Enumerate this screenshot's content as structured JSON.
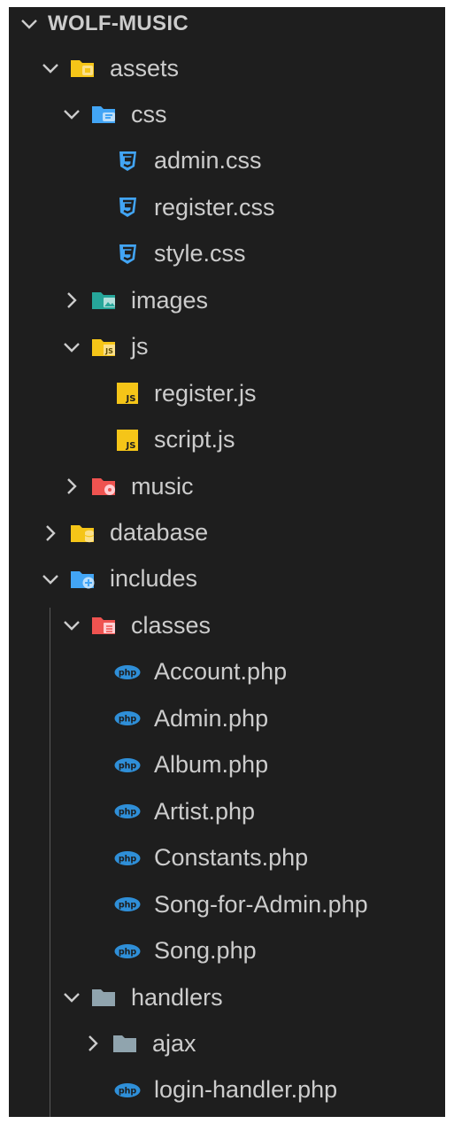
{
  "explorer": {
    "root": "WOLF-MUSIC",
    "items": [
      {
        "label": "assets",
        "type": "folder",
        "icon": "assets-folder-icon",
        "depth": 1,
        "expanded": true
      },
      {
        "label": "css",
        "type": "folder",
        "icon": "css-folder-icon",
        "depth": 2,
        "expanded": true
      },
      {
        "label": "admin.css",
        "type": "file",
        "icon": "css3-file-icon",
        "depth": 3
      },
      {
        "label": "register.css",
        "type": "file",
        "icon": "css3-file-icon",
        "depth": 3
      },
      {
        "label": "style.css",
        "type": "file",
        "icon": "css3-file-icon",
        "depth": 3
      },
      {
        "label": "images",
        "type": "folder",
        "icon": "images-folder-icon",
        "depth": 2,
        "expanded": false
      },
      {
        "label": "js",
        "type": "folder",
        "icon": "js-folder-icon",
        "depth": 2,
        "expanded": true
      },
      {
        "label": "register.js",
        "type": "file",
        "icon": "js-file-icon",
        "depth": 3
      },
      {
        "label": "script.js",
        "type": "file",
        "icon": "js-file-icon",
        "depth": 3
      },
      {
        "label": "music",
        "type": "folder",
        "icon": "music-folder-icon",
        "depth": 2,
        "expanded": false
      },
      {
        "label": "database",
        "type": "folder",
        "icon": "database-folder-icon",
        "depth": 1,
        "expanded": false
      },
      {
        "label": "includes",
        "type": "folder",
        "icon": "includes-folder-icon",
        "depth": 1,
        "expanded": true
      },
      {
        "label": "classes",
        "type": "folder",
        "icon": "classes-folder-icon",
        "depth": 2,
        "expanded": true
      },
      {
        "label": "Account.php",
        "type": "file",
        "icon": "php-file-icon",
        "depth": 3
      },
      {
        "label": "Admin.php",
        "type": "file",
        "icon": "php-file-icon",
        "depth": 3
      },
      {
        "label": "Album.php",
        "type": "file",
        "icon": "php-file-icon",
        "depth": 3
      },
      {
        "label": "Artist.php",
        "type": "file",
        "icon": "php-file-icon",
        "depth": 3
      },
      {
        "label": "Constants.php",
        "type": "file",
        "icon": "php-file-icon",
        "depth": 3
      },
      {
        "label": "Song-for-Admin.php",
        "type": "file",
        "icon": "php-file-icon",
        "depth": 3
      },
      {
        "label": "Song.php",
        "type": "file",
        "icon": "php-file-icon",
        "depth": 3
      },
      {
        "label": "handlers",
        "type": "folder",
        "icon": "handlers-folder-icon",
        "depth": 2,
        "expanded": true
      },
      {
        "label": "ajax",
        "type": "folder",
        "icon": "folder-icon",
        "depth": 3,
        "expanded": false
      },
      {
        "label": "login-handler.php",
        "type": "file",
        "icon": "php-file-icon",
        "depth": 3
      }
    ]
  },
  "icon_text": {
    "php": "php",
    "js": "JS"
  },
  "colors": {
    "background": "#1e1e1e",
    "text": "#cccccc",
    "indent_guide": "#585858",
    "folder_yellow": "#f5c518",
    "folder_blue": "#42a5f5",
    "folder_teal": "#26a69a",
    "folder_red": "#ef5350",
    "folder_gray": "#90a4ae",
    "css_blue": "#42a5f5",
    "js_yellow": "#f5c518",
    "php_blue": "#2f8fd8"
  }
}
